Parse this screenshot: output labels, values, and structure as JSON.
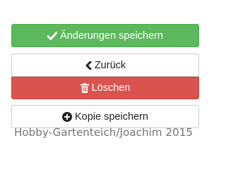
{
  "buttons": {
    "save": {
      "label": "Änderungen speichern",
      "icon": "check-icon",
      "color": "#5cb85c"
    },
    "back": {
      "label": "Zurück",
      "icon": "chevron-left-icon"
    },
    "delete": {
      "label": "Löschen",
      "icon": "trash-icon",
      "color": "#d9534f"
    },
    "copy": {
      "label": "Kopie speichern",
      "icon": "plus-circle-icon"
    }
  },
  "watermark": {
    "text": "Hobby-Gartenteich/Joachim 2015"
  }
}
